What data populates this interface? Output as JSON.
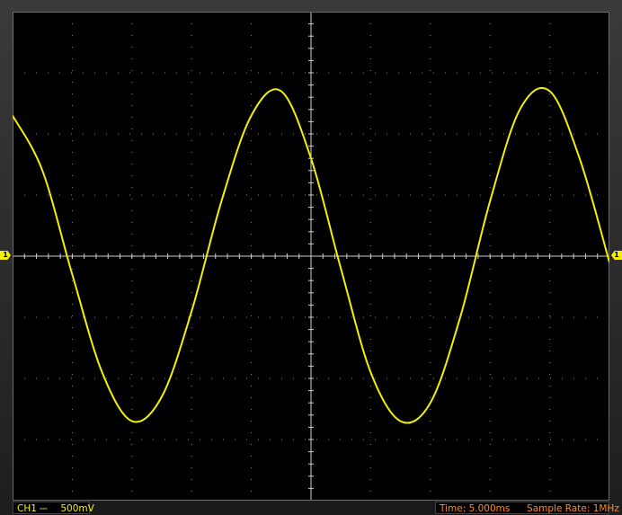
{
  "channel": {
    "label": "CH1",
    "coupling_symbol": "⎓",
    "volts_per_div": "500mV",
    "trigger_marker": "1",
    "color": "#f5f000"
  },
  "timebase": {
    "time_label": "Time: 5.000ms",
    "sample_rate_label": "Sample Rate: 1MHz",
    "color": "#ff8a1c"
  },
  "chart_data": {
    "type": "line",
    "title": "",
    "xlabel": "",
    "ylabel": "",
    "x_divisions": 10,
    "y_divisions": 8,
    "grid": true,
    "xlim": [
      0,
      10
    ],
    "ylim": [
      -4,
      4
    ],
    "series": [
      {
        "color": "#f5f000",
        "x": [
          0.0,
          0.5,
          1.0,
          1.5,
          2.0,
          2.5,
          3.0,
          3.5,
          4.0,
          4.5,
          5.0,
          5.5,
          6.0,
          6.5,
          7.0,
          7.5,
          8.0,
          8.5,
          9.0,
          9.5,
          10.0
        ],
        "values": [
          2.3,
          1.4,
          -0.3,
          -1.9,
          -2.7,
          -2.3,
          -0.9,
          0.9,
          2.3,
          2.7,
          1.6,
          -0.2,
          -1.9,
          -2.7,
          -2.4,
          -1.0,
          0.9,
          2.4,
          2.7,
          1.6,
          -0.1
        ],
        "peaks_div": [
          2.7,
          -2.7
        ]
      }
    ]
  }
}
